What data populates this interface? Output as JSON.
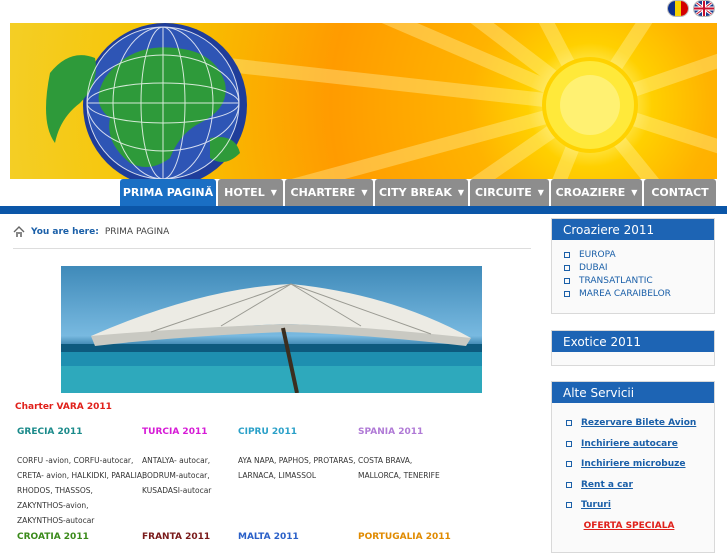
{
  "colors": {
    "accent": "#1d64b4",
    "tab_gray": "#8d8d8d",
    "charter_red": "#e0201a"
  },
  "header": {
    "flags": [
      "flag-romania-icon",
      "flag-uk-icon"
    ]
  },
  "nav": {
    "tabs": [
      {
        "label": "PRIMA PAGINĂ",
        "dropdown": false,
        "active": true
      },
      {
        "label": "HOTEL",
        "dropdown": true
      },
      {
        "label": "CHARTERE",
        "dropdown": true
      },
      {
        "label": "CITY BREAK",
        "dropdown": true
      },
      {
        "label": "CIRCUITE",
        "dropdown": true
      },
      {
        "label": "CROAZIERE",
        "dropdown": true
      },
      {
        "label": "CONTACT",
        "dropdown": false
      }
    ]
  },
  "breadcrumb": {
    "label": "You are here:",
    "current": "PRIMA PAGINA"
  },
  "content": {
    "charter_title": "Charter VARA 2011",
    "destinations": [
      {
        "name": "GRECIA 2011",
        "color": "#1a8a8a",
        "lines": [
          "CORFU -avion, CORFU-autocar,",
          "CRETA- avion, HALKIDKI, PARALIA,",
          "RHODOS, THASSOS,",
          "ZAKYNTHOS-avion,",
          "ZAKYNTHOS-autocar"
        ]
      },
      {
        "name": "TURCIA 2011",
        "color": "#d61ad6",
        "lines": [
          "ANTALYA- autocar,",
          "BODRUM-autocar,",
          "KUSADASI-autocar"
        ]
      },
      {
        "name": "CIPRU 2011",
        "color": "#2aa0c8",
        "lines": [
          "AYA NAPA, PAPHOS, PROTARAS,",
          "LARNACA, LIMASSOL"
        ]
      },
      {
        "name": "SPANIA 2011",
        "color": "#b07ad6",
        "lines": [
          "COSTA BRAVA,",
          "MALLORCA, TENERIFE"
        ]
      }
    ],
    "row2": [
      {
        "name": "CROATIA 2011",
        "color": "#3a8a1a"
      },
      {
        "name": "FRANTA 2011",
        "color": "#7a1a1a"
      },
      {
        "name": "MALTA 2011",
        "color": "#2a60c8"
      },
      {
        "name": "PORTUGALIA 2011",
        "color": "#e08a00"
      }
    ]
  },
  "sidebar": {
    "croaziere": {
      "title": "Croaziere 2011",
      "items": [
        "EUROPA",
        "DUBAI",
        "TRANSATLANTIC",
        "MAREA CARAIBELOR"
      ]
    },
    "exotice": {
      "title": "Exotice 2011"
    },
    "servicii": {
      "title": "Alte Servicii",
      "items": [
        "Rezervare Bilete Avion",
        "Inchiriere autocare",
        "Inchiriere microbuze",
        "Rent a car",
        "Tururi"
      ],
      "special": "OFERTA SPECIALA"
    }
  }
}
